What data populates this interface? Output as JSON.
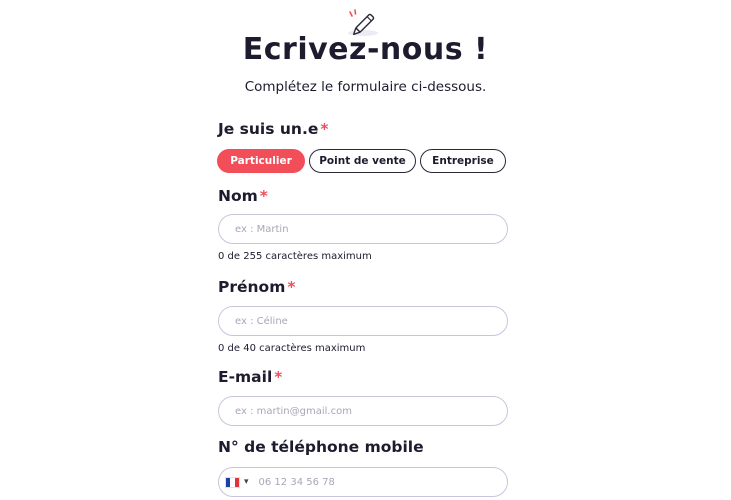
{
  "header": {
    "icon": "pencil-icon",
    "title": "Ecrivez-nous !",
    "subtitle": "Complétez le formulaire ci-dessous."
  },
  "form": {
    "required_mark": "*",
    "profile": {
      "label": "Je suis un.e",
      "options": [
        "Particulier",
        "Point de vente",
        "Entreprise"
      ],
      "selected": "Particulier"
    },
    "nom": {
      "label": "Nom",
      "placeholder": "ex : Martin",
      "value": "",
      "helper": "0 de 255 caractères maximum"
    },
    "prenom": {
      "label": "Prénom",
      "placeholder": "ex : Céline",
      "value": "",
      "helper": "0 de 40 caractères maximum"
    },
    "email": {
      "label": "E-mail",
      "placeholder": "ex : martin@gmail.com",
      "value": ""
    },
    "phone": {
      "label": "N° de téléphone mobile",
      "country": "France",
      "flag_icon": "france-flag-icon",
      "placeholder": "06 12 34 56 78",
      "value": ""
    }
  },
  "colors": {
    "accent": "#f24e5a",
    "text": "#1d1b2e",
    "input_border": "#c9c5dc"
  }
}
